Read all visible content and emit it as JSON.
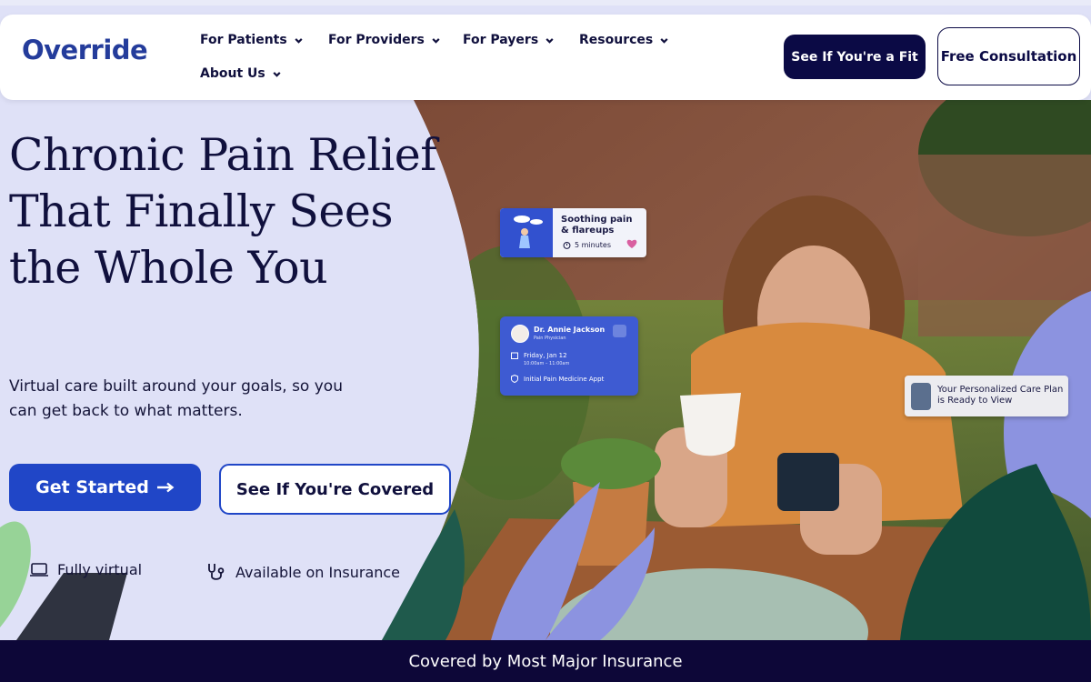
{
  "brand": {
    "logo": "Override",
    "color": "#243c9b"
  },
  "nav": {
    "items": [
      {
        "label": "For Patients"
      },
      {
        "label": "For Providers"
      },
      {
        "label": "For Payers"
      },
      {
        "label": "Resources"
      },
      {
        "label": "About Us"
      }
    ],
    "fit_button": "See If You're a Fit",
    "consult_button": "Free Consultation"
  },
  "hero": {
    "headline": "Chronic Pain Relief That Finally Sees the Whole You",
    "subhead": "Virtual care built around your goals, so you can get back to what matters.",
    "primary_cta": "Get Started",
    "primary_cta_icon": "arrow-right-icon",
    "secondary_cta": "See If You're Covered",
    "features": [
      {
        "label": "Fully virtual",
        "icon": "laptop-icon"
      },
      {
        "label": "Available on Insurance",
        "icon": "stethoscope-icon"
      }
    ]
  },
  "cards": {
    "session": {
      "title": "Soothing pain & flareups",
      "duration": "5 minutes"
    },
    "appointment": {
      "name": "Dr. Annie Jackson",
      "role": "Pain Physician",
      "date": "Friday, Jan 12",
      "time": "10:00am – 11:00am",
      "appt": "Initial Pain Medicine Appt"
    },
    "careplan": {
      "text": "Your Personalized Care Plan is Ready to View"
    }
  },
  "footer": {
    "banner": "Covered by Most Major Insurance"
  },
  "colors": {
    "primary": "#2046c7",
    "navy": "#0b0a45",
    "lavender": "#dfe1f7"
  }
}
